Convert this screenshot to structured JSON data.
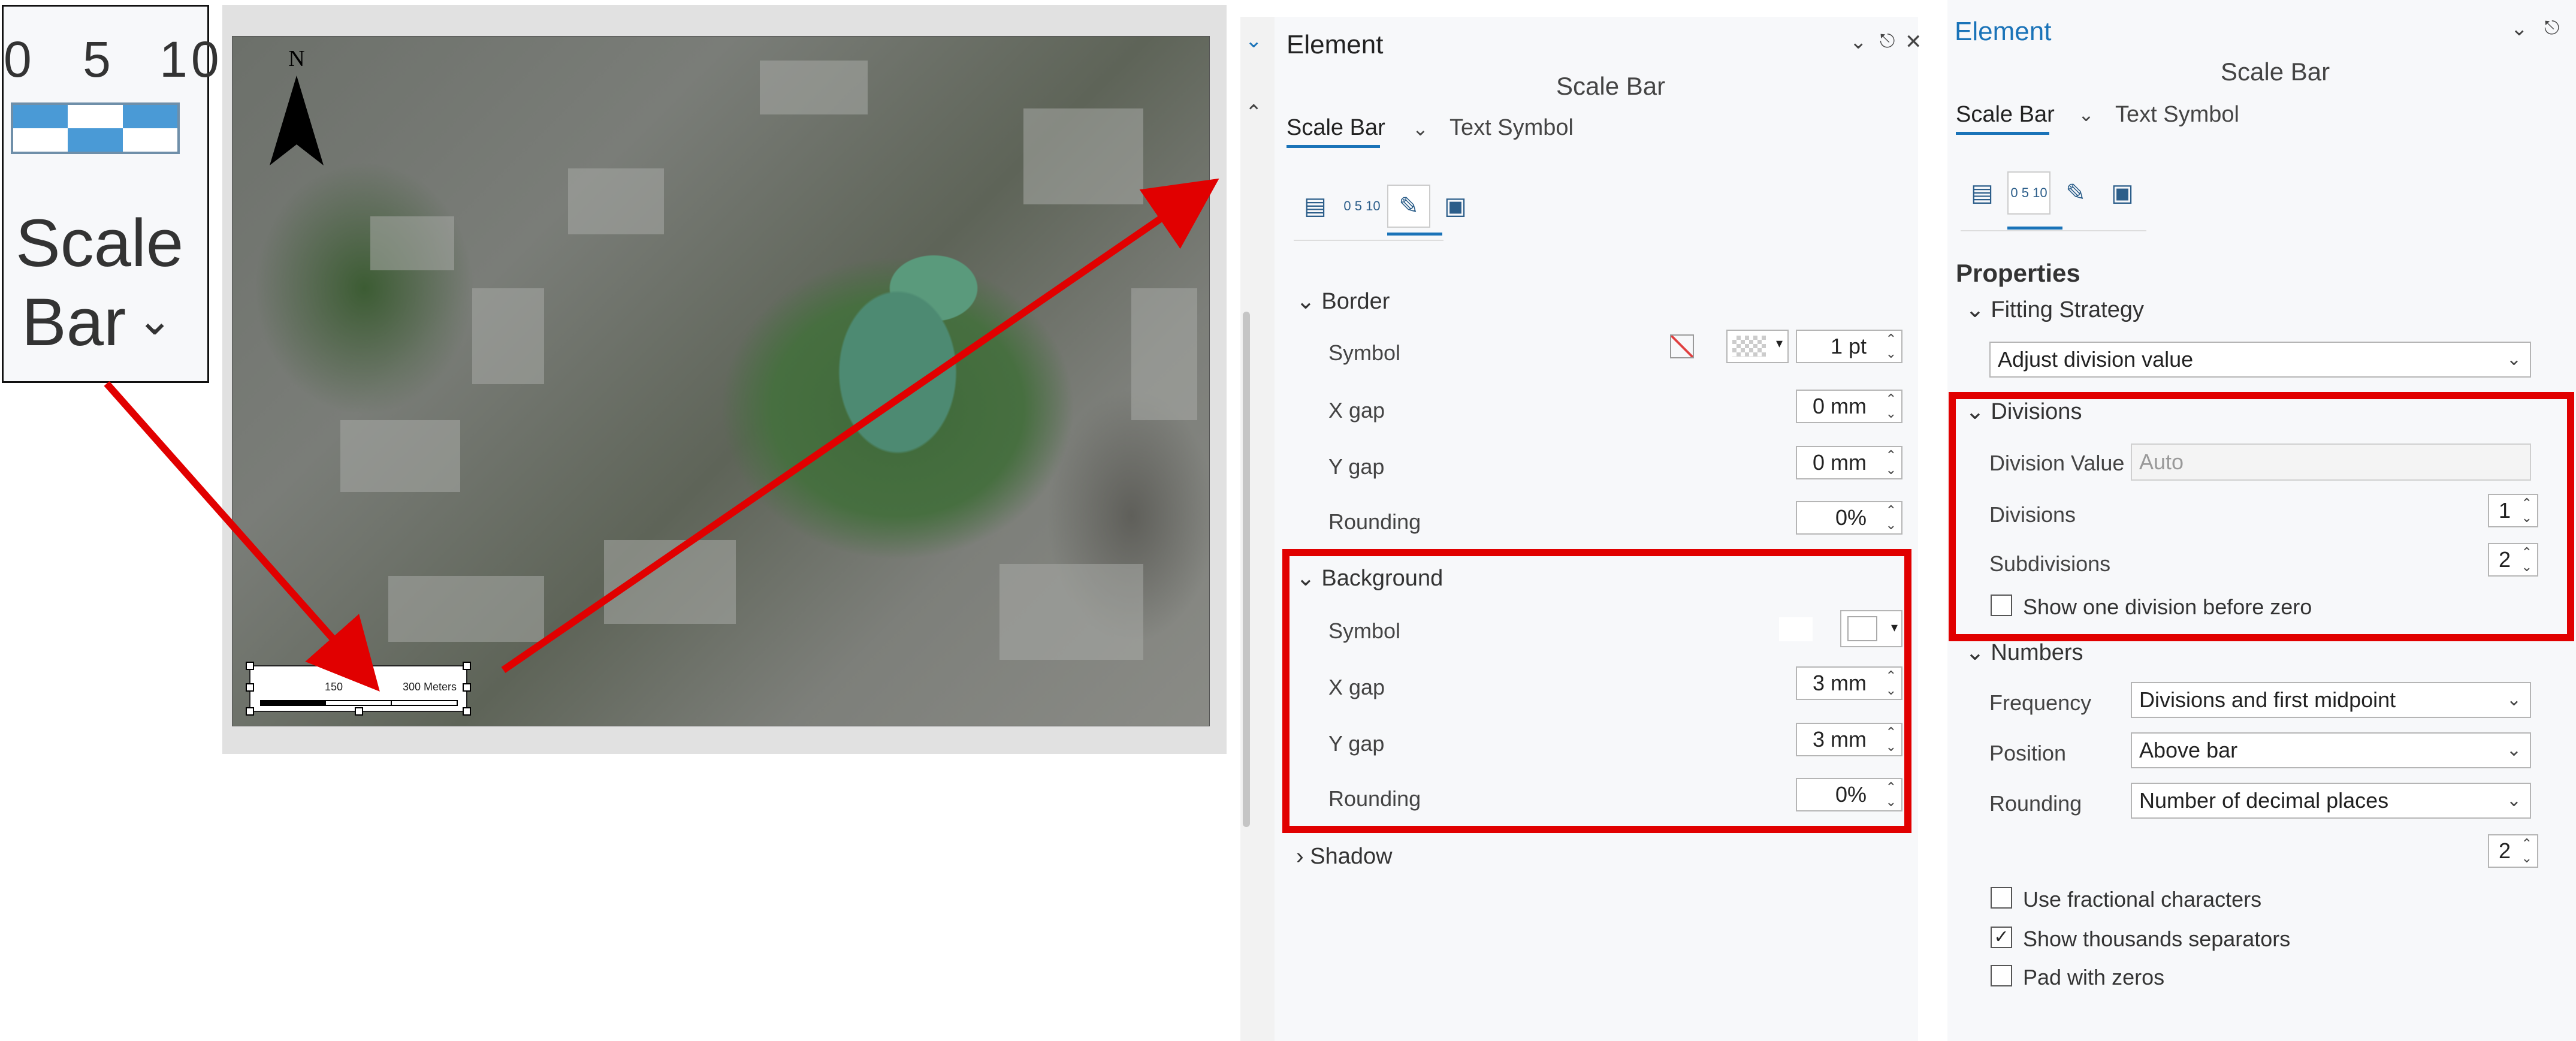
{
  "ribbon_zoom": {
    "tick_labels": [
      "0",
      "5",
      "10"
    ],
    "label_line1": "Scale",
    "label_line2": "Bar",
    "chevron": "chevron-down-icon"
  },
  "map": {
    "north_label": "N",
    "scalebar": {
      "label_mid": "150",
      "label_end": "300 Meters"
    }
  },
  "panel1": {
    "title": "Element",
    "subtitle": "Scale Bar",
    "tabs": [
      {
        "label": "Scale Bar",
        "active": true
      },
      {
        "label": "Text Symbol",
        "active": false
      }
    ],
    "icon_tabs": [
      "options-icon",
      "scalebar-properties-icon",
      "display-brush-icon",
      "placement-icon"
    ],
    "active_icon_index": 2,
    "sections": {
      "border": {
        "header": "Border",
        "symbol_label": "Symbol",
        "symbol_value": "1 pt",
        "x_gap_label": "X gap",
        "x_gap_value": "0 mm",
        "y_gap_label": "Y gap",
        "y_gap_value": "0 mm",
        "rounding_label": "Rounding",
        "rounding_value": "0%"
      },
      "background": {
        "header": "Background",
        "symbol_label": "Symbol",
        "x_gap_label": "X gap",
        "x_gap_value": "3 mm",
        "y_gap_label": "Y gap",
        "y_gap_value": "3 mm",
        "rounding_label": "Rounding",
        "rounding_value": "0%"
      },
      "shadow": {
        "header": "Shadow"
      }
    }
  },
  "panel2": {
    "title": "Element",
    "subtitle": "Scale Bar",
    "tabs": [
      {
        "label": "Scale Bar",
        "active": true
      },
      {
        "label": "Text Symbol",
        "active": false
      }
    ],
    "icon_tabs": [
      "options-icon",
      "scalebar-properties-icon",
      "display-brush-icon",
      "placement-icon"
    ],
    "active_icon_index": 1,
    "properties_header": "Properties",
    "fitting_strategy": {
      "header": "Fitting Strategy",
      "value": "Adjust division value"
    },
    "divisions": {
      "header": "Divisions",
      "division_value_label": "Division Value",
      "division_value_placeholder": "Auto",
      "divisions_label": "Divisions",
      "divisions_value": "1",
      "subdivisions_label": "Subdivisions",
      "subdivisions_value": "2",
      "show_one_division_label": "Show one division before zero",
      "show_one_division_checked": false
    },
    "numbers": {
      "header": "Numbers",
      "frequency_label": "Frequency",
      "frequency_value": "Divisions and first midpoint",
      "position_label": "Position",
      "position_value": "Above bar",
      "rounding_label": "Rounding",
      "rounding_value": "Number of decimal places",
      "decimal_places_value": "2",
      "use_fractional_label": "Use fractional characters",
      "use_fractional_checked": false,
      "show_thousands_label": "Show thousands separators",
      "show_thousands_checked": true,
      "pad_zeros_label": "Pad with zeros",
      "pad_zeros_checked": false
    }
  },
  "colors": {
    "highlight": "#e10000",
    "accent": "#1a73b8",
    "panel_bg": "#f7f8fa"
  }
}
